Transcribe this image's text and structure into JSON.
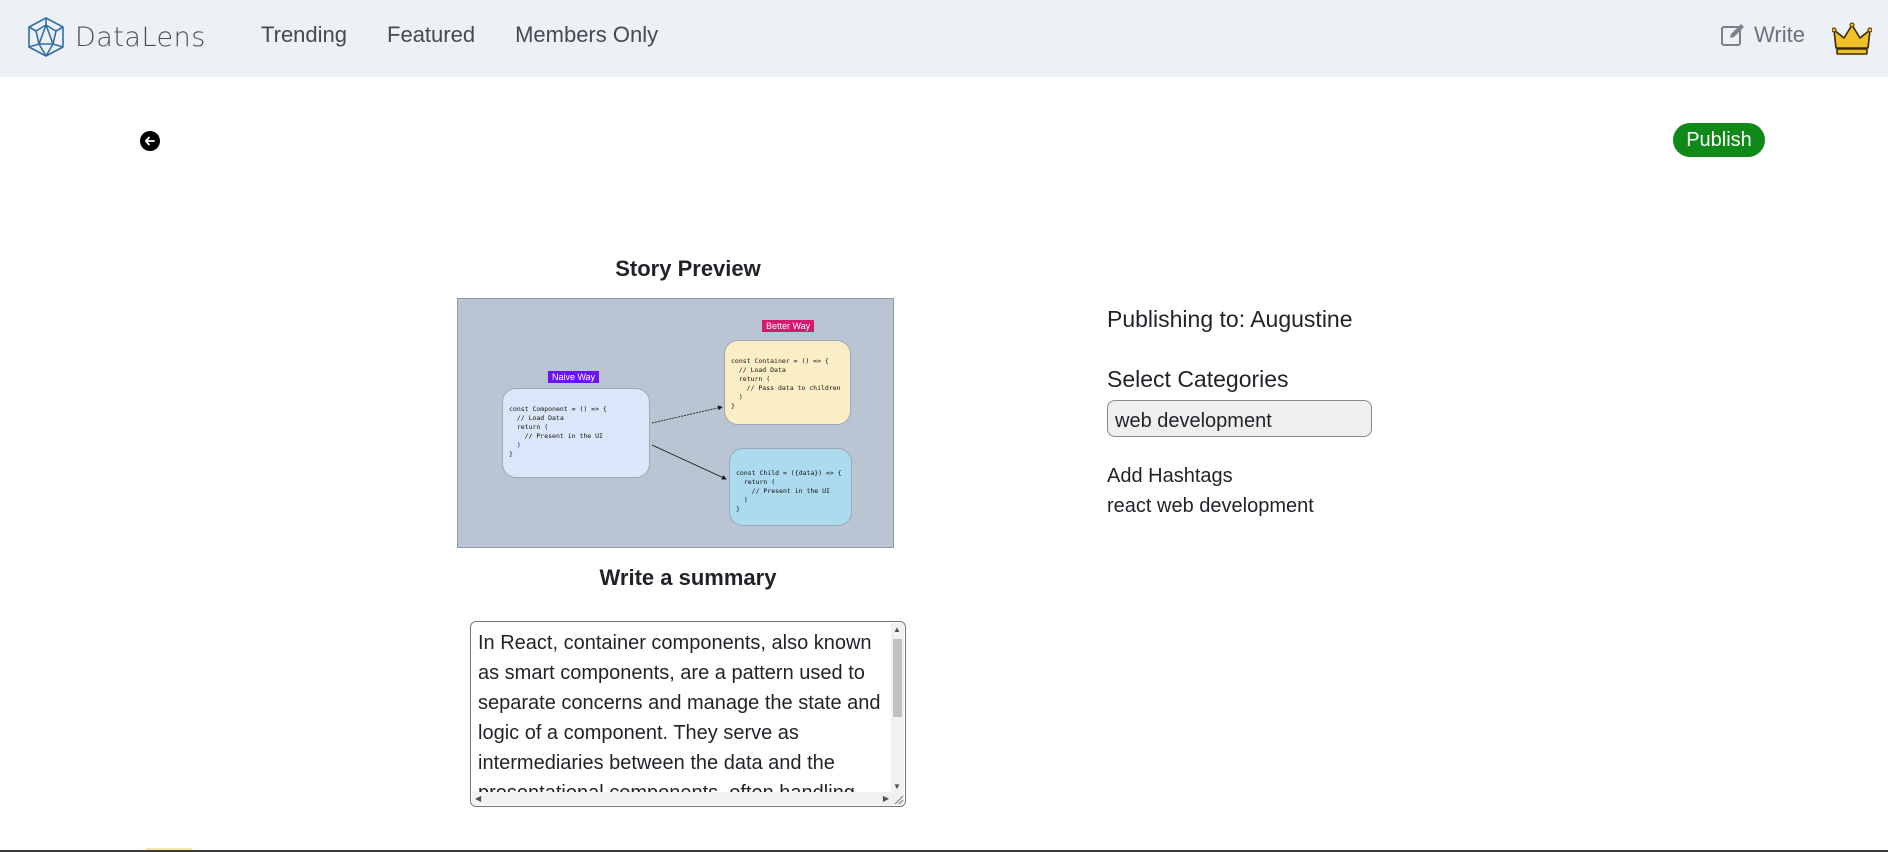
{
  "header": {
    "brand": "DataLens",
    "nav": [
      "Trending",
      "Featured",
      "Members Only"
    ],
    "write_label": "Write",
    "logo_icon": "polyhedron-logo-icon",
    "crown_icon": "crown-icon"
  },
  "actions": {
    "back_icon": "arrow-left-icon",
    "publish_label": "Publish",
    "publish_color": "#0f8a18"
  },
  "preview": {
    "heading": "Story Preview",
    "image": {
      "naive_tag": "Naive Way",
      "better_tag": "Better Way",
      "naive_code": "const Component = () => {\n  // Load Data\n  return (\n    // Present in the UI\n  )\n}",
      "container_code": "const Container = () => {\n  // Load Data\n  return (\n    // Pass data to children\n  )\n}",
      "child_code": "const Child = ({data}) => {\n  return (\n    // Present in the UI\n  )\n}"
    }
  },
  "summary": {
    "heading": "Write a summary",
    "text": "In React, container components, also known as smart components, are a pattern used to separate concerns and manage the state and logic of a component. They serve as intermediaries between the data and the presentational components, often handling"
  },
  "publishing": {
    "label": "Publishing to: Augustine",
    "categories_label": "Select Categories",
    "category_value": "web development",
    "hashtags_label": "Add Hashtags",
    "hashtags_value": "react web development"
  }
}
